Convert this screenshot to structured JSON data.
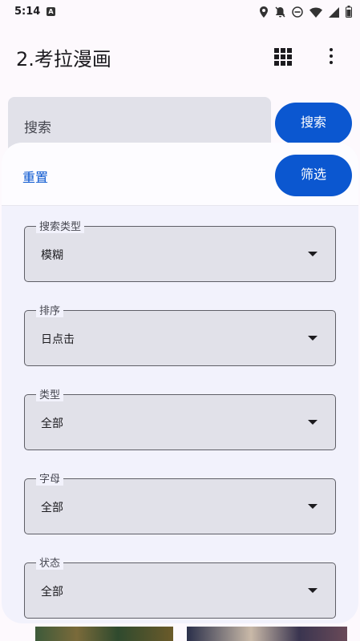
{
  "status_bar": {
    "time": "5:14",
    "app_icon": "A",
    "icons": [
      "location-icon",
      "bell-off-icon",
      "dnd-icon",
      "wifi-icon",
      "signal-icon",
      "battery-icon"
    ]
  },
  "app_bar": {
    "title": "2.考拉漫画",
    "actions": [
      "grid-view-icon",
      "more-vert-icon"
    ]
  },
  "search": {
    "placeholder": "搜索",
    "button_label": "搜索"
  },
  "filter_sheet": {
    "reset_label": "重置",
    "filter_label": "筛选",
    "fields": [
      {
        "label": "搜索类型",
        "value": "模糊"
      },
      {
        "label": "排序",
        "value": "日点击"
      },
      {
        "label": "类型",
        "value": "全部"
      },
      {
        "label": "字母",
        "value": "全部"
      },
      {
        "label": "状态",
        "value": "全部"
      }
    ]
  },
  "colors": {
    "accent": "#0b57d0",
    "sheet_background": "#f2f2fc",
    "field_fill": "#e1e1e9"
  }
}
